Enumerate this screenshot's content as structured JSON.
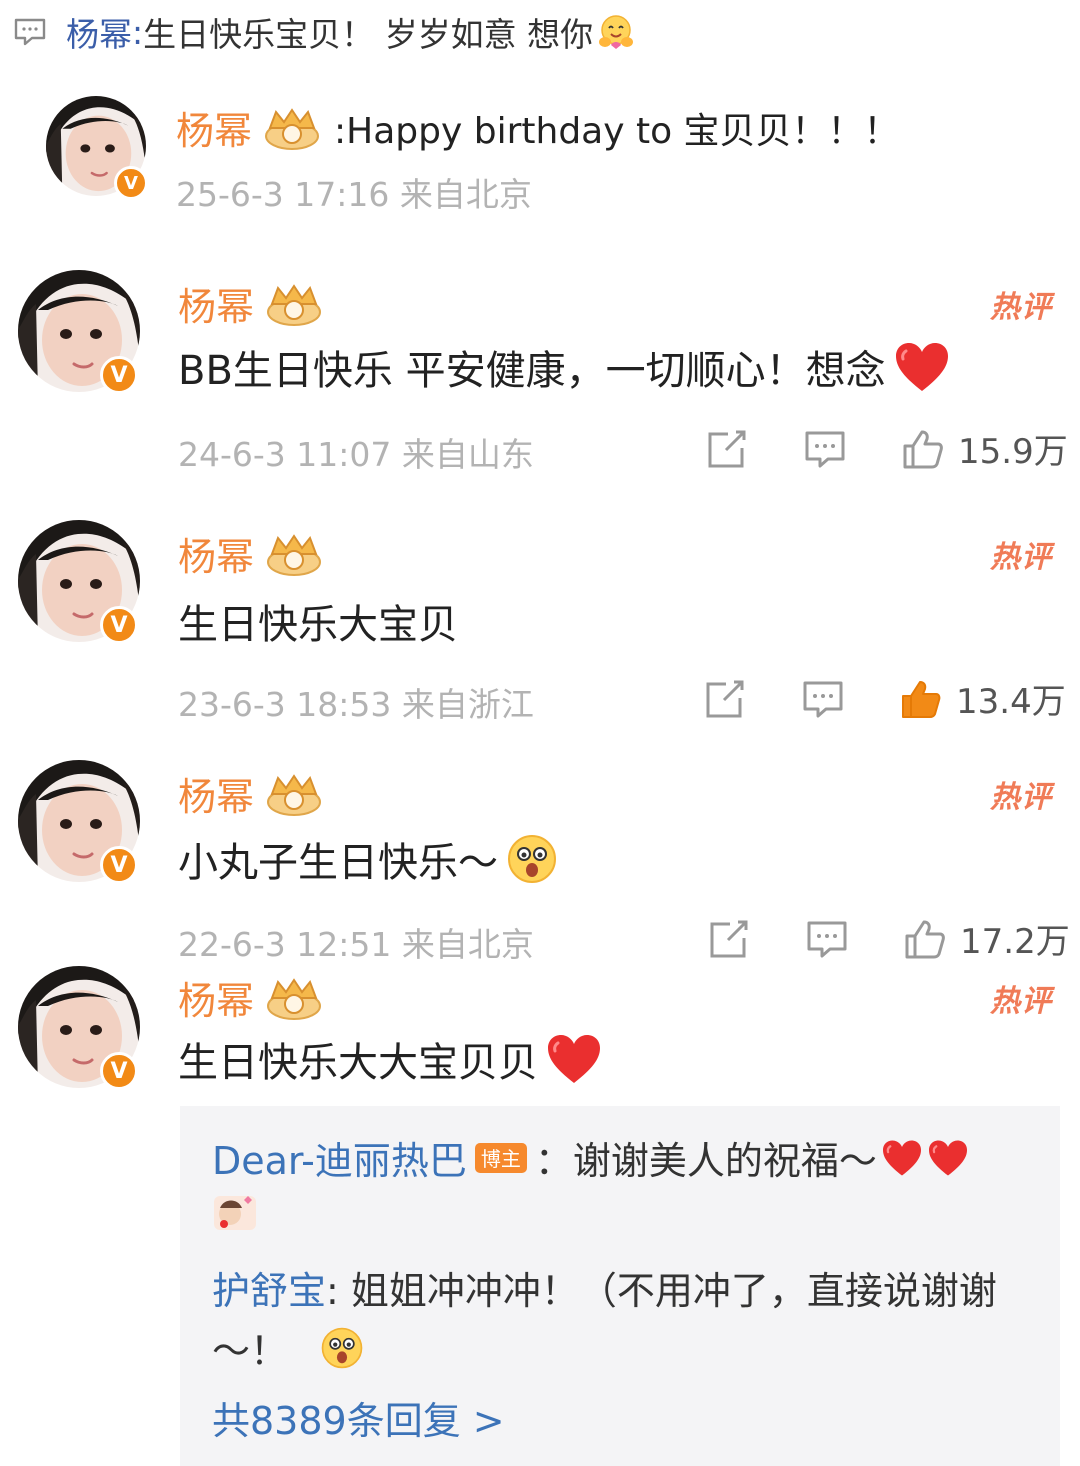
{
  "top": {
    "author": "杨幂",
    "separator": ": ",
    "text": "生日快乐宝贝！ 岁岁如意 想你",
    "emoji": "hug-emoji"
  },
  "comments": [
    {
      "name": "杨幂",
      "level": "10",
      "inline_text": ":Happy birthday to 宝贝贝！！！",
      "meta": "25-6-3 17:16 来自北京"
    },
    {
      "name": "杨幂",
      "level": "10",
      "hot": "热评",
      "text": "BB生日快乐 平安健康，一切顺心！想念",
      "meta": "24-6-3 11:07 来自山东",
      "likes": "15.9万",
      "liked": false
    },
    {
      "name": "杨幂",
      "level": "10",
      "hot": "热评",
      "text": "生日快乐大宝贝",
      "meta": "23-6-3 18:53 来自浙江",
      "likes": "13.4万",
      "liked": true
    },
    {
      "name": "杨幂",
      "level": "10",
      "hot": "热评",
      "text": "小丸子生日快乐～",
      "meta": "22-6-3 12:51 来自北京",
      "likes": "17.2万",
      "liked": false
    },
    {
      "name": "杨幂",
      "level": "9",
      "hot": "热评",
      "text": "生日快乐大大宝贝贝"
    }
  ],
  "replies": [
    {
      "name": "Dear-迪丽热巴",
      "badge": "博主",
      "text": "：谢谢美人的祝福～"
    },
    {
      "name": "护舒宝",
      "text": ": 姐姐冲冲冲！（不用冲了，直接说谢谢",
      "text_cont": "～！"
    }
  ],
  "more_replies": "共8389条回复 >",
  "colors": {
    "name_orange": "#f1873b",
    "hot_red": "#f07b57",
    "link_blue": "#3c73b8",
    "like_orange": "#f28a16",
    "meta_gray": "#b3b3b3"
  }
}
